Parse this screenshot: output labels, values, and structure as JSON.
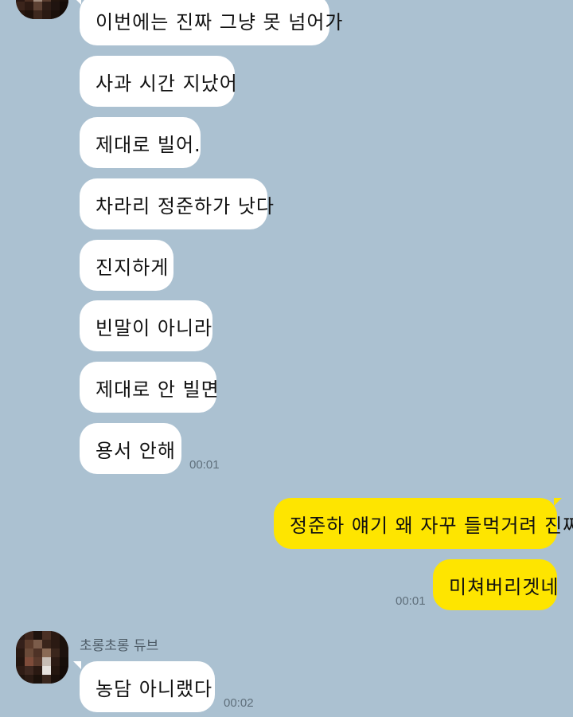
{
  "colors": {
    "background": "#abc1d1",
    "incoming_bubble": "#ffffff",
    "outgoing_bubble": "#fee500"
  },
  "messages_top": [
    "이번에는 진짜 그냥 못 넘어가",
    "사과 시간 지났어",
    "제대로 빌어.",
    "차라리 정준하가 낫다",
    "진지하게",
    "빈말이 아니라",
    "제대로 안 빌면",
    "용서 안해"
  ],
  "time_top": "00:01",
  "outgoing": [
    "정준하 얘기 왜 자꾸 들먹거려 진짜",
    "미쳐버리겟네"
  ],
  "time_outgoing": "00:01",
  "sender_name": "초롱초롱 듀브",
  "last_message": "농담 아니랬다",
  "time_last": "00:02"
}
